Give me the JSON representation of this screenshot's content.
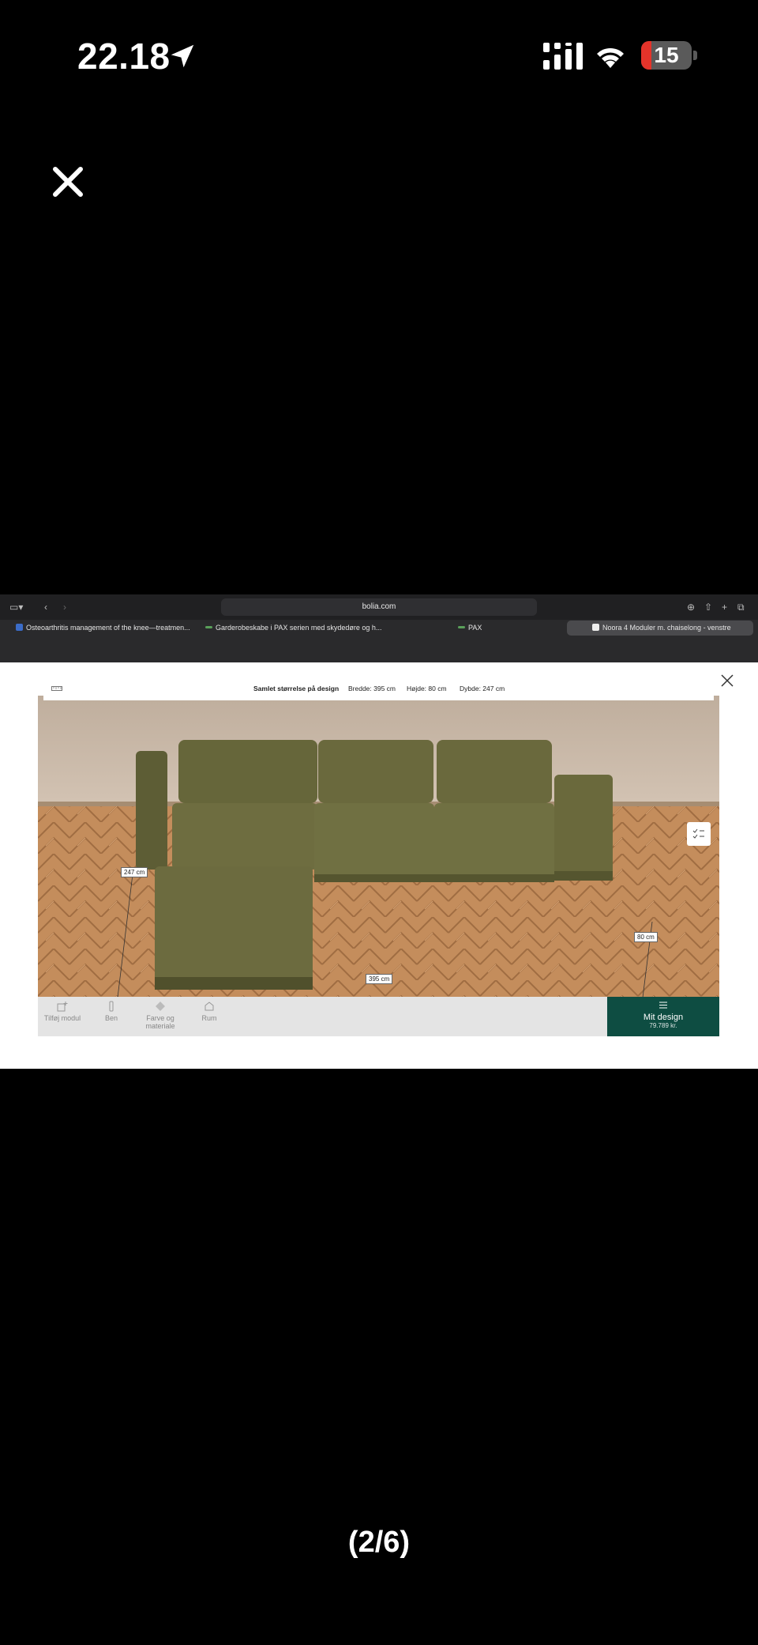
{
  "status_bar": {
    "time": "22.18",
    "battery": "15"
  },
  "safari": {
    "url": "bolia.com",
    "tabs": [
      {
        "label": "Osteoarthritis management of the knee—treatmen..."
      },
      {
        "label": "Garderobeskabe i PAX serien med skydedøre og h..."
      },
      {
        "label": "PAX"
      },
      {
        "label": "Noora 4 Moduler m. chaiselong - venstre"
      }
    ]
  },
  "configurator": {
    "summary_title": "Samlet størrelse på design",
    "width_text": "Bredde: 395 cm",
    "height_text": "Højde: 80 cm",
    "depth_text": "Dybde: 247 cm",
    "dim_depth": "247 cm",
    "dim_height": "80 cm",
    "dim_width": "395 cm",
    "tools": [
      {
        "label": "Tilføj modul",
        "icon": "add-module-icon"
      },
      {
        "label": "Ben",
        "icon": "leg-icon"
      },
      {
        "label": "Farve og materiale",
        "icon": "material-icon"
      },
      {
        "label": "Rum",
        "icon": "room-icon"
      }
    ],
    "my_design": {
      "label": "Mit design",
      "price": "79.789 kr."
    }
  },
  "viewer": {
    "counter": "(2/6)"
  },
  "colors": {
    "accent": "#0e4d42",
    "sofa": "#6b6a3c",
    "floor": "#c08a5a",
    "wall": "#c9b8a7"
  }
}
